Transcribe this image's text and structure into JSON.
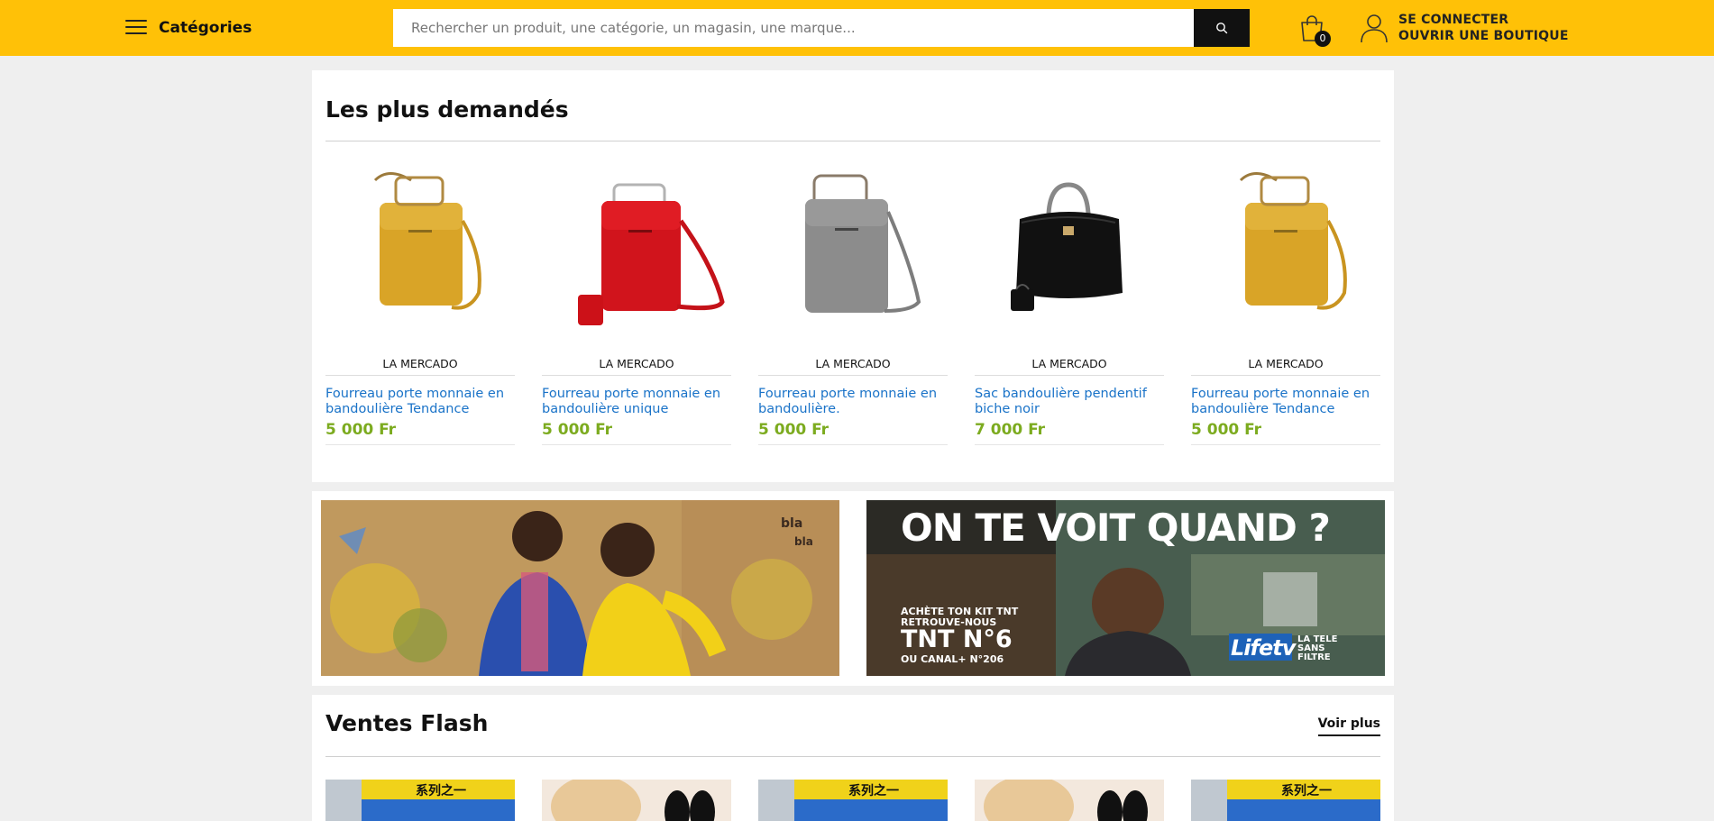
{
  "header": {
    "categories_label": "Catégories",
    "search_placeholder": "Rechercher un produit, une catégorie, un magasin, une marque...",
    "cart_count": "0",
    "login_label": "SE CONNECTER",
    "open_shop_label": "OUVRIR UNE BOUTIQUE",
    "colors": {
      "bar": "#ffc107",
      "search_button": "#111111"
    }
  },
  "most_requested": {
    "title": "Les plus demandés",
    "products": [
      {
        "store": "LA MERCADO",
        "name": "Fourreau porte monnaie en bandoulière Tendance",
        "price": "5 000 Fr",
        "image": "yellow-bag"
      },
      {
        "store": "LA MERCADO",
        "name": "Fourreau porte monnaie en bandoulière unique",
        "price": "5 000 Fr",
        "image": "red-bag"
      },
      {
        "store": "LA MERCADO",
        "name": "Fourreau porte monnaie en bandoulière.",
        "price": "5 000 Fr",
        "image": "grey-bag"
      },
      {
        "store": "LA MERCADO",
        "name": "Sac bandoulière pendentif biche noir",
        "price": "7 000 Fr",
        "image": "black-handbag"
      },
      {
        "store": "LA MERCADO",
        "name": "Fourreau porte monnaie en bandoulière Tendance",
        "price": "5 000 Fr",
        "image": "yellow-bag"
      }
    ],
    "colors": {
      "link": "#1a73c8",
      "price": "#7cab1f"
    }
  },
  "banners": {
    "left": {
      "image": "two-women-gossip-banner",
      "text": "bla bla"
    },
    "right": {
      "headline": "ON TE VOIT QUAND ?",
      "line1": "ACHÈTE TON KIT TNT",
      "line2": "RETROUVE-NOUS",
      "channel": "TNT N°6",
      "line3": "OU CANAL+ N°206",
      "logo": "Lifetv",
      "tagline": "LA TELE SANS FILTRE"
    }
  },
  "flash_sales": {
    "title": "Ventes Flash",
    "see_more": "Voir plus",
    "items": [
      "blue-package",
      "shoe-insoles",
      "blue-package",
      "shoe-insoles",
      "blue-package"
    ],
    "package_text": "系列之一"
  }
}
